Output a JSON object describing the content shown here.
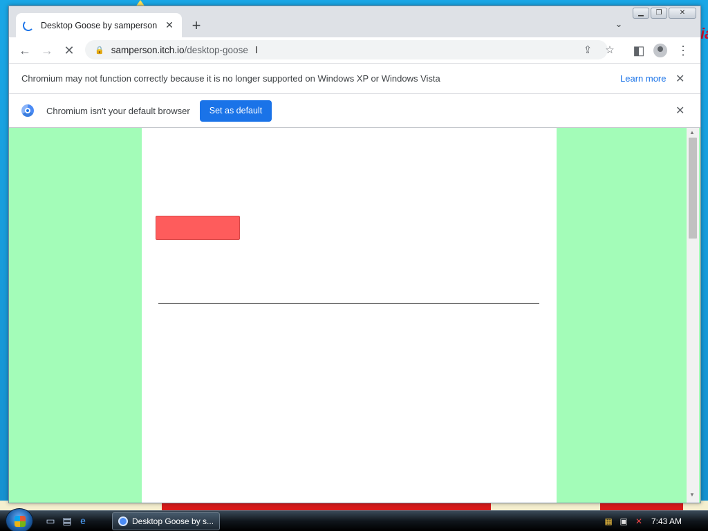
{
  "tab": {
    "title": "Desktop Goose by samperson",
    "close_glyph": "✕"
  },
  "newtab_glyph": "+",
  "tabsearch_glyph": "⌄",
  "window_controls": {
    "minimize": "▁",
    "maximize": "❐",
    "close": "✕"
  },
  "nav": {
    "back": "←",
    "forward": "→",
    "stop": "✕"
  },
  "address": {
    "host": "samperson.itch.io",
    "path": "/desktop-goose",
    "lock_icon": "lock-icon"
  },
  "toolbar_icons": {
    "share": "⇪",
    "bookmark": "☆",
    "side_panel": "◧",
    "menu": "⋮"
  },
  "infobar_unsupported": {
    "message": "Chromium may not function correctly because it is no longer supported on Windows XP or Windows Vista",
    "learn_more": "Learn more",
    "close_glyph": "✕"
  },
  "infobar_default": {
    "message": "Chromium isn't your default browser",
    "button": "Set as default",
    "close_glyph": "✕"
  },
  "scroll": {
    "up": "▲",
    "down": "▼"
  },
  "taskbar": {
    "task_title": "Desktop Goose by s...",
    "time": "7:43 AM"
  },
  "desktop_text": "ia",
  "colors": {
    "page_background": "#a3fcb8",
    "red_button": "#fe5c5c",
    "accent": "#1a73e8"
  }
}
